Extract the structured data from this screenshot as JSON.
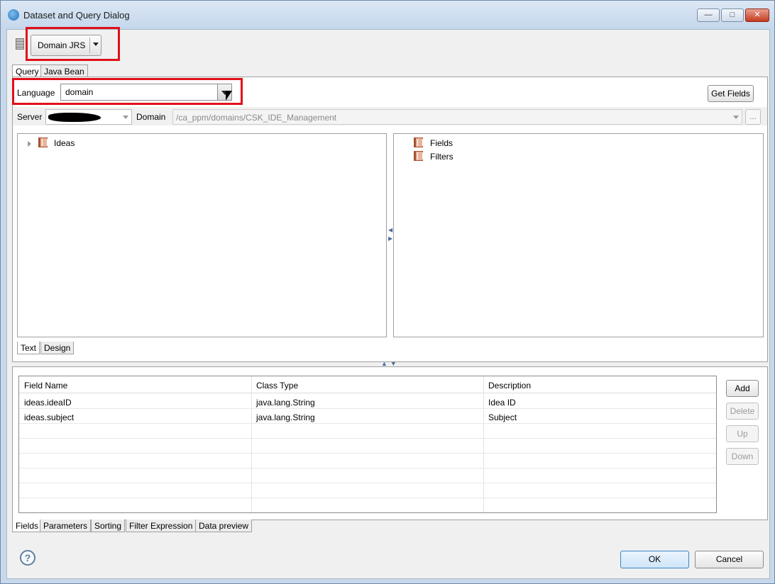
{
  "window": {
    "title": "Dataset and Query Dialog",
    "controls": {
      "minimize": "—",
      "maximize": "□",
      "close": "✕"
    }
  },
  "datasource": {
    "button_label": "Domain JRS"
  },
  "query_tabs": [
    {
      "label": "Query",
      "active": true
    },
    {
      "label": "Java Bean",
      "active": false
    }
  ],
  "query": {
    "language_label": "Language",
    "language_value": "domain",
    "get_fields_label": "Get Fields",
    "server_label": "Server",
    "domain_label": "Domain",
    "domain_value": "/ca_ppm/domains/CSK_IDE_Management",
    "browse_label": "..."
  },
  "left_tree": [
    {
      "label": "Ideas",
      "expandable": true
    }
  ],
  "right_tree": [
    {
      "label": "Fields"
    },
    {
      "label": "Filters"
    }
  ],
  "editor_tabs": [
    {
      "label": "Text",
      "active": true
    },
    {
      "label": "Design",
      "active": false
    }
  ],
  "fields_table": {
    "columns": [
      "Field Name",
      "Class Type",
      "Description"
    ],
    "rows": [
      [
        "ideas.ideaID",
        "java.lang.String",
        "Idea ID"
      ],
      [
        "ideas.subject",
        "java.lang.String",
        "Subject"
      ]
    ]
  },
  "table_buttons": {
    "add": "Add",
    "delete": "Delete",
    "up": "Up",
    "down": "Down"
  },
  "bottom_tabs": [
    {
      "label": "Fields",
      "active": true
    },
    {
      "label": "Parameters",
      "active": false
    },
    {
      "label": "Sorting",
      "active": false
    },
    {
      "label": "Filter Expression",
      "active": false
    },
    {
      "label": "Data preview",
      "active": false
    }
  ],
  "footer": {
    "help": "?",
    "ok": "OK",
    "cancel": "Cancel"
  }
}
